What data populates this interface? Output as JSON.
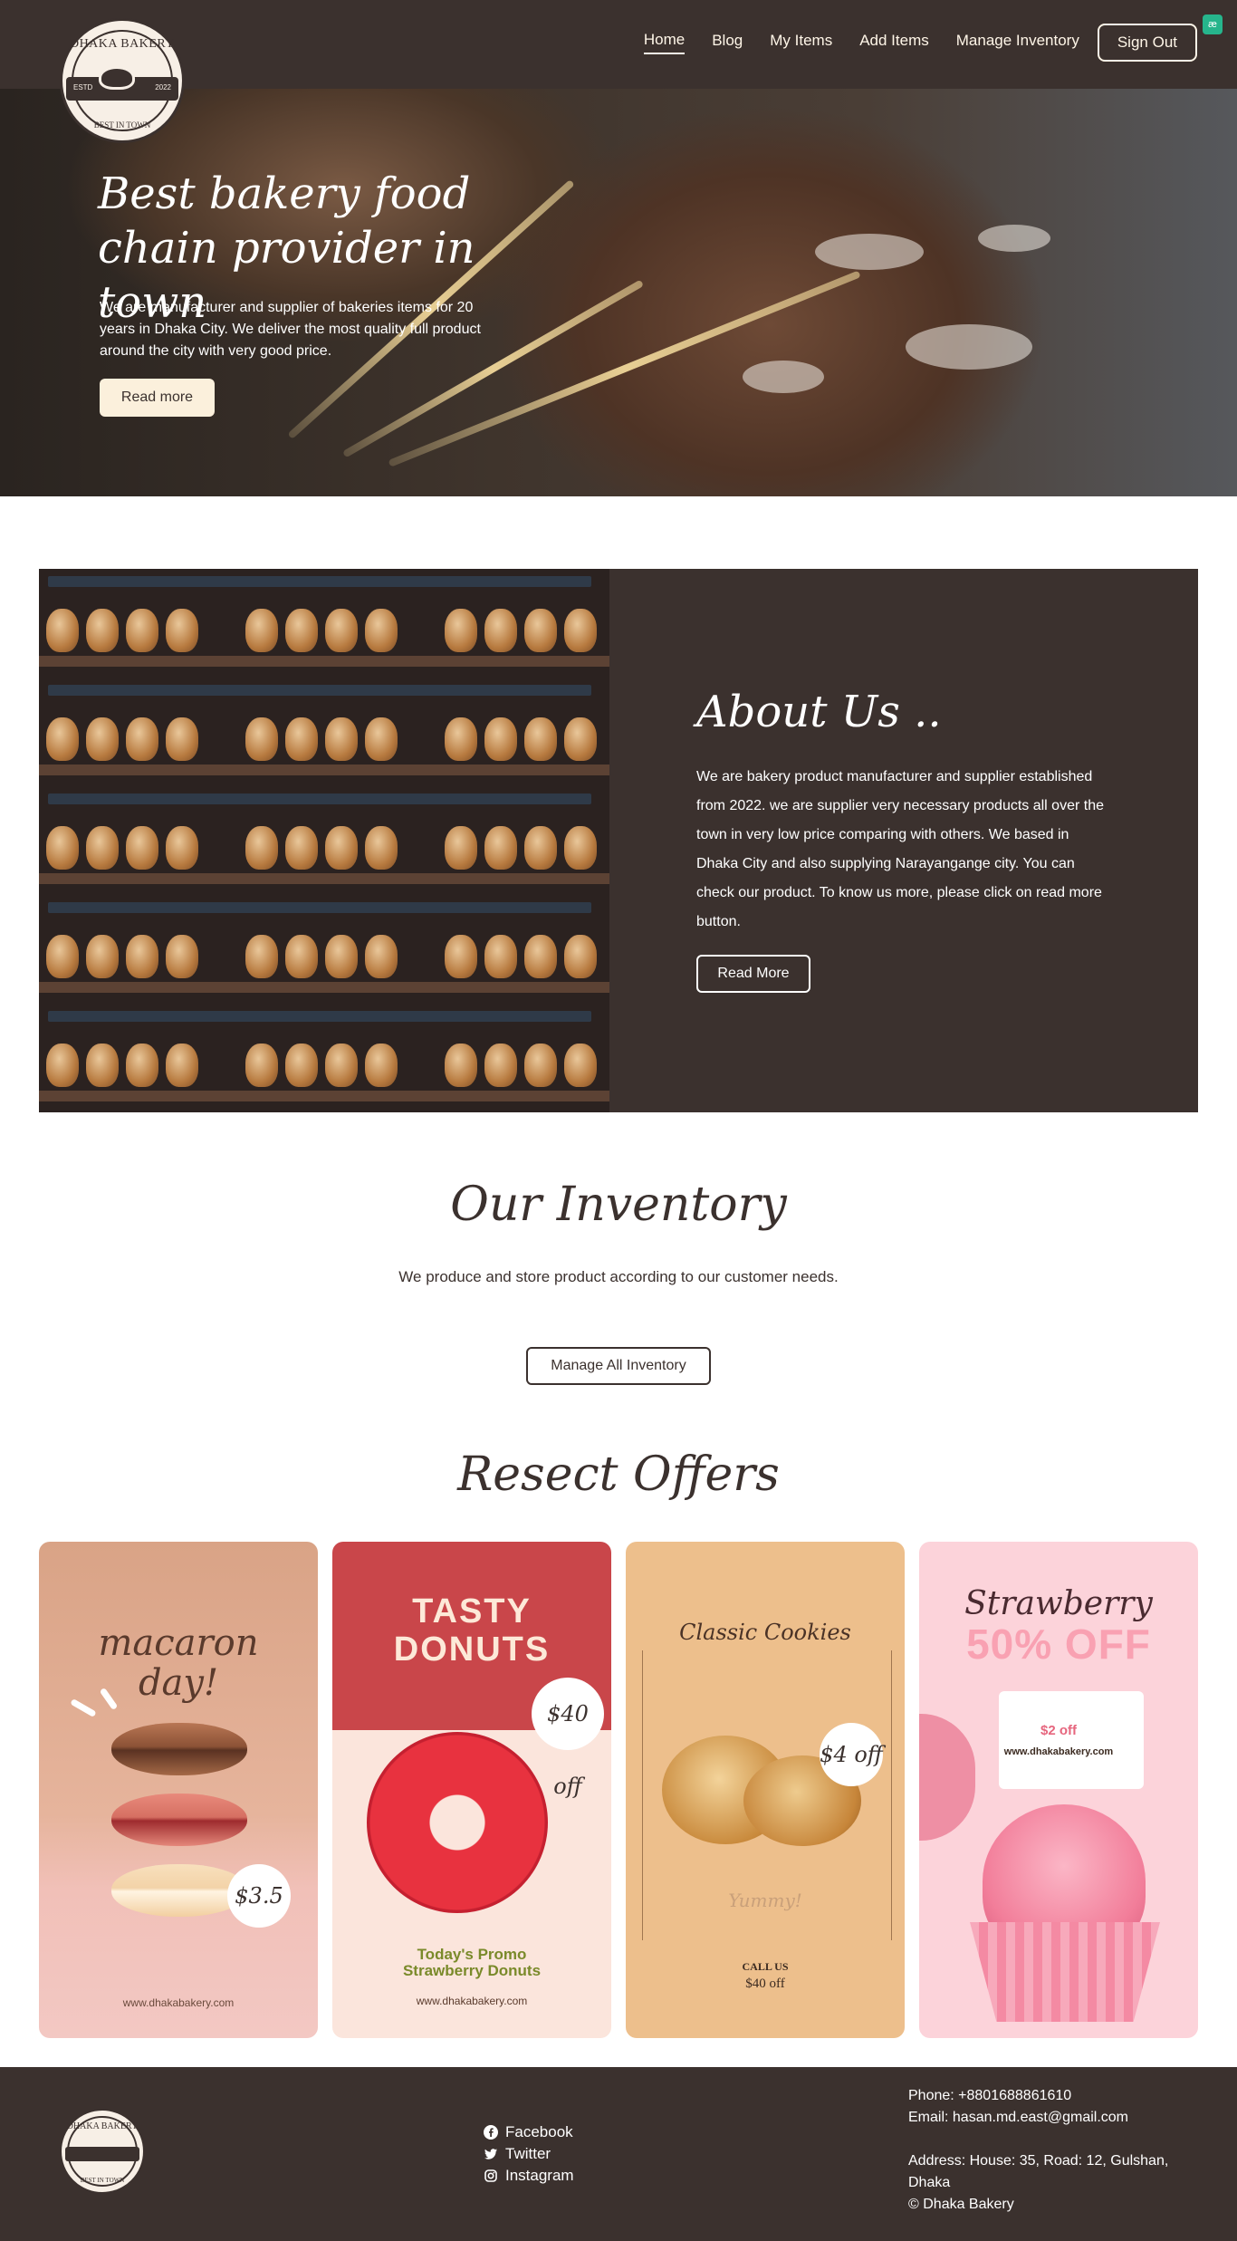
{
  "brand": {
    "logo_top": "DHAKA BAKERY",
    "logo_est": "ESTD",
    "logo_year": "2022",
    "logo_bottom": "BEST IN TOWN"
  },
  "nav": {
    "items": [
      {
        "label": "Home",
        "active": true
      },
      {
        "label": "Blog",
        "active": false
      },
      {
        "label": "My Items",
        "active": false
      },
      {
        "label": "Add Items",
        "active": false
      },
      {
        "label": "Manage Inventory",
        "active": false
      }
    ],
    "signout": "Sign Out"
  },
  "hero": {
    "title": "Best bakery food chain provider in town",
    "text": "We are manufacturer and supplier of bakeries items for 20 years in Dhaka City. We deliver the most quality full product around the city with very good price.",
    "button": "Read more"
  },
  "about": {
    "title": "About Us ..",
    "text": "We are bakery product manufacturer and supplier established from 2022. we are supplier very necessary products all over the town in very low price comparing with others. We based in Dhaka City and also supplying Narayangange city. You can check our product. To know us more, please click on read more button.",
    "button": "Read More"
  },
  "inventory": {
    "title": "Our Inventory",
    "subtitle": "We produce and store product according to our customer needs.",
    "button": "Manage All Inventory"
  },
  "offers": {
    "title": "Resect Offers",
    "cards": [
      {
        "heading": "macaron day!",
        "price": "$3.5",
        "site": "www.dhakabakery.com"
      },
      {
        "heading1": "TASTY",
        "heading2": "DONUTS",
        "price": "$40 off",
        "promo1": "Today's Promo",
        "promo2": "Strawberry Donuts",
        "site": "www.dhakabakery.com"
      },
      {
        "heading": "Classic Cookies",
        "price": "$4 off",
        "yummy": "Yummy!",
        "call": "CALL US",
        "call_price": "$40 off"
      },
      {
        "heading": "Strawberry",
        "big": "50% OFF",
        "price": "$2 off",
        "site": "www.dhakabakery.com"
      }
    ]
  },
  "footer": {
    "social": [
      {
        "label": "Facebook",
        "icon": "facebook-icon"
      },
      {
        "label": "Twitter",
        "icon": "twitter-icon"
      },
      {
        "label": "Instagram",
        "icon": "instagram-icon"
      }
    ],
    "phone": "Phone: +8801688861610",
    "email": "Email: hasan.md.east@gmail.com",
    "address": "Address: House: 35, Road: 12, Gulshan, Dhaka",
    "copyright": "© Dhaka Bakery"
  },
  "colors": {
    "primary": "#3b312e",
    "cream": "#fbf0dc",
    "badge": "#26b58c"
  }
}
